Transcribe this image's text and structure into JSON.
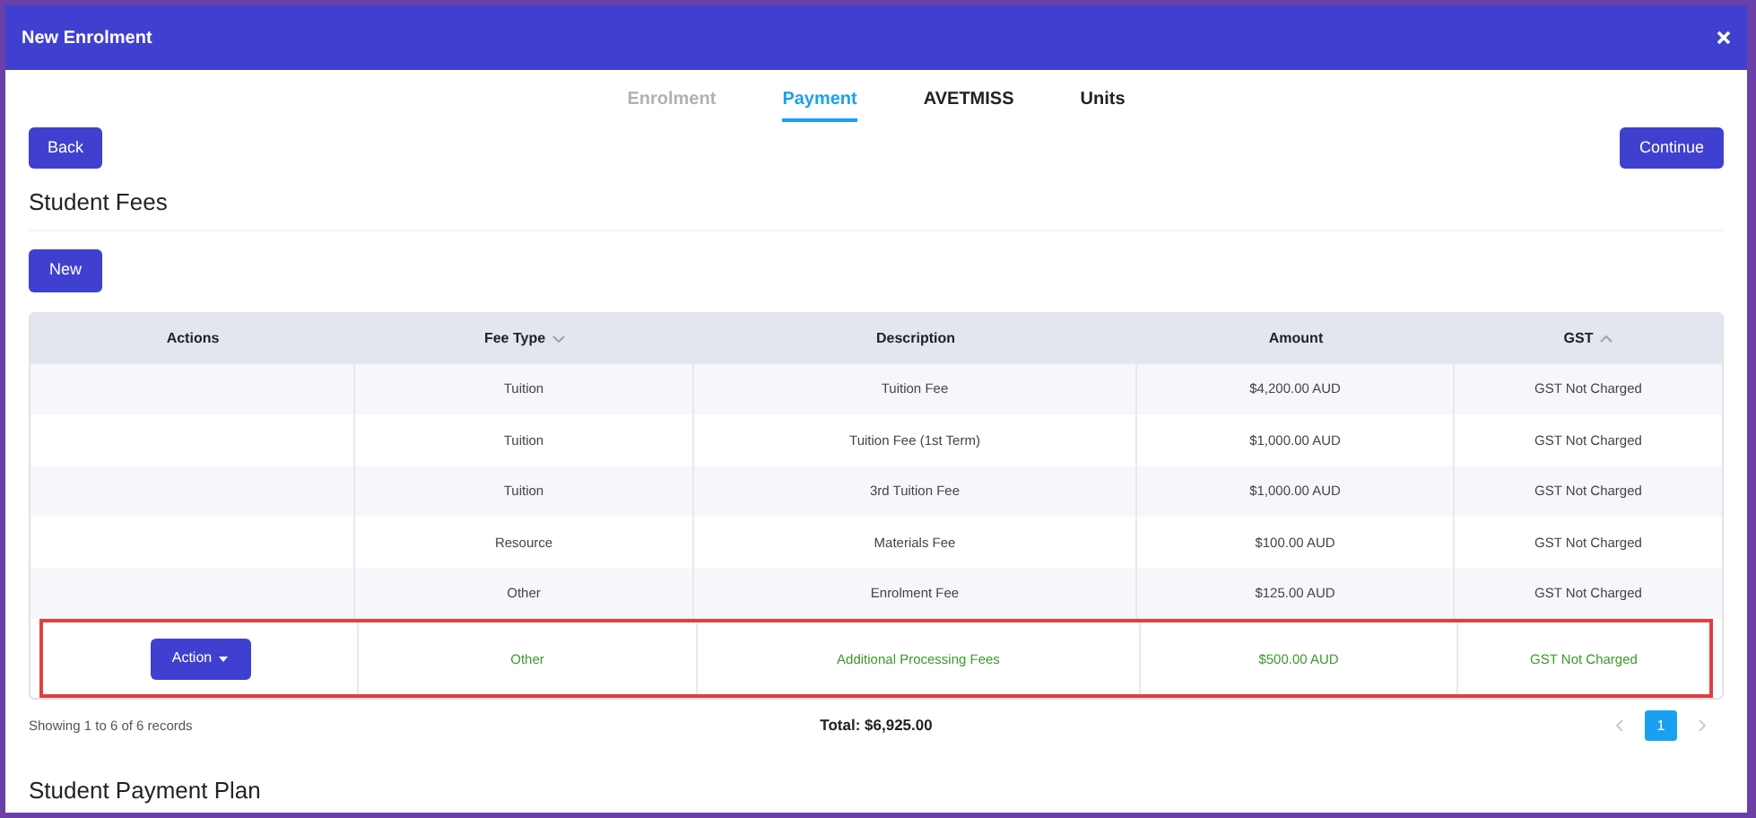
{
  "window": {
    "title": "New Enrolment"
  },
  "tabs": [
    {
      "label": "Enrolment",
      "selected": false,
      "disabled": true
    },
    {
      "label": "Payment",
      "selected": true,
      "disabled": false
    },
    {
      "label": "AVETMISS",
      "selected": false,
      "disabled": false
    },
    {
      "label": "Units",
      "selected": false,
      "disabled": false
    }
  ],
  "buttons": {
    "back": "Back",
    "continue": "Continue",
    "new": "New"
  },
  "section_title": "Student Fees",
  "table": {
    "columns": [
      {
        "label": "Actions"
      },
      {
        "label": "Fee Type",
        "sorted_ascending": false
      },
      {
        "label": "Description"
      },
      {
        "label": "Amount"
      },
      {
        "label": "GST",
        "sorted_ascending": true
      }
    ],
    "rows": [
      {
        "highlighted": false,
        "cells": [
          "",
          "Tuition",
          "Tuition Fee",
          "$4,200.00 AUD",
          "GST Not Charged"
        ]
      },
      {
        "highlighted": false,
        "cells": [
          "",
          "Tuition",
          "Tuition Fee (1st Term)",
          "$1,000.00 AUD",
          "GST Not Charged"
        ]
      },
      {
        "highlighted": false,
        "cells": [
          "",
          "Tuition",
          "3rd Tuition Fee",
          "$1,000.00 AUD",
          "GST Not Charged"
        ]
      },
      {
        "highlighted": false,
        "cells": [
          "",
          "Resource",
          "Materials Fee",
          "$100.00 AUD",
          "GST Not Charged"
        ]
      },
      {
        "highlighted": false,
        "cells": [
          "",
          "Other",
          "Enrolment Fee",
          "$125.00 AUD",
          "GST Not Charged"
        ]
      },
      {
        "highlighted": true,
        "cells": [
          "Action",
          "Other",
          "Additional Processing Fees",
          "$500.00 AUD",
          "GST Not Charged"
        ]
      }
    ]
  },
  "footer": {
    "records": "Showing 1 to 6 of 6 records",
    "total": "Total: $6,925.00",
    "pages": [
      {
        "label": "1",
        "selected": true
      }
    ]
  },
  "next_section_title": "Student Payment Plan"
}
